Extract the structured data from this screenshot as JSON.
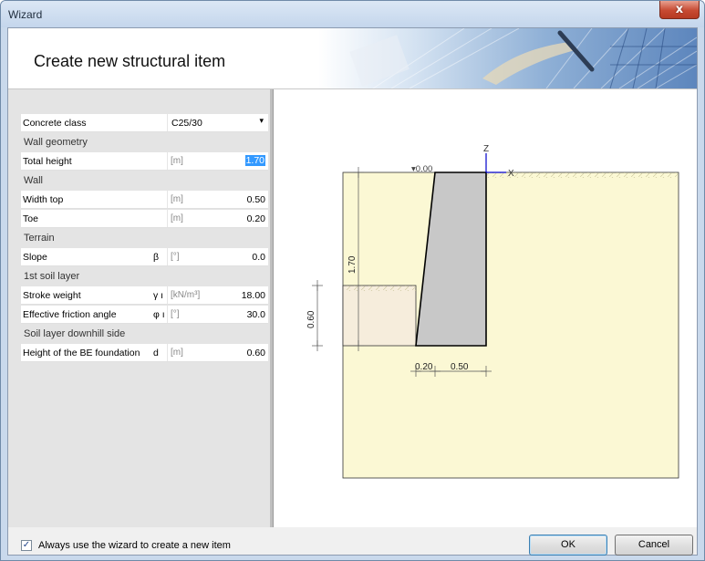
{
  "window": {
    "title": "Wizard",
    "close_glyph": "x"
  },
  "header": {
    "title": "Create new structural item"
  },
  "properties": {
    "concrete_class": {
      "label": "Concrete class",
      "value": "C25/30",
      "arrow": "▾"
    },
    "groups": {
      "wall_geometry": "Wall geometry",
      "wall": "Wall",
      "terrain": "Terrain",
      "soil1": "1st soil layer",
      "downhill": "Soil layer downhill side"
    },
    "rows": {
      "total_height": {
        "label": "Total height",
        "symbol": "",
        "unit": "[m]",
        "value": "1.70"
      },
      "width_top": {
        "label": "Width top",
        "symbol": "",
        "unit": "[m]",
        "value": "0.50"
      },
      "toe": {
        "label": "Toe",
        "symbol": "",
        "unit": "[m]",
        "value": "0.20"
      },
      "slope": {
        "label": "Slope",
        "symbol": "β",
        "unit": "[°]",
        "value": "0.0"
      },
      "stroke_weight": {
        "label": "Stroke weight",
        "symbol": "γ ı",
        "unit": "[kN/m³]",
        "value": "18.00"
      },
      "friction_angle": {
        "label": "Effective friction angle",
        "symbol": "φ ı",
        "unit": "[°]",
        "value": "30.0"
      },
      "foundation_height": {
        "label": "Height of the BE foundation",
        "symbol": "d",
        "unit": "[m]",
        "value": "0.60"
      }
    }
  },
  "drawing": {
    "level_label": "▾0.00",
    "axis_z": "Z",
    "axis_x": "X",
    "dim_height": "1.70",
    "dim_foundation": "0.60",
    "dim_toe": "0.20",
    "dim_width": "0.50",
    "colors": {
      "soil": "#fbf8d4",
      "soil_downhill": "#f6eddc",
      "wall": "#c8c8c8",
      "axis": "#0000cc",
      "dims": "#555555"
    }
  },
  "footer": {
    "checkbox_checked": true,
    "checkbox_mark": "✓",
    "checkbox_label": "Always use the wizard to create a new item",
    "ok_label": "OK",
    "cancel_label": "Cancel"
  }
}
